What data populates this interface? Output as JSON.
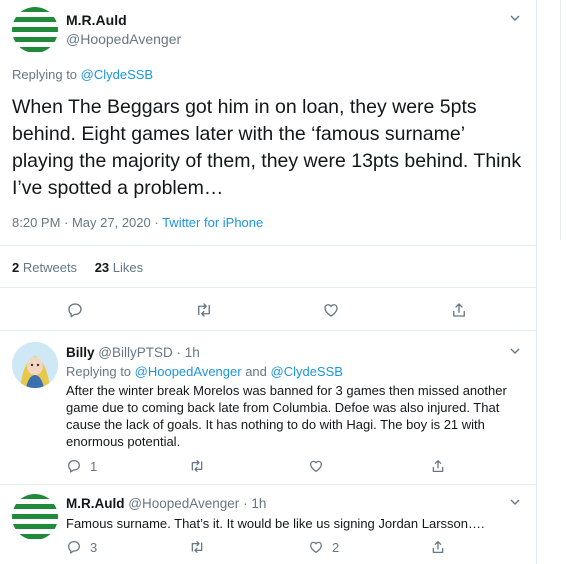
{
  "main_tweet": {
    "author_name": "M.R.Auld",
    "author_handle": "@HoopedAvenger",
    "replying_prefix": "Replying to ",
    "replying_to": "@ClydeSSB",
    "text": "When The Beggars got him in on loan, they were 5pts behind. Eight games later with the ‘famous surname’ playing the majority of them, they were 13pts behind. Think I’ve spotted a problem…",
    "timestamp": "8:20 PM · May 27, 2020",
    "source_sep": " · ",
    "source": "Twitter for iPhone",
    "retweets_count": "2",
    "retweets_label": "Retweets",
    "likes_count": "23",
    "likes_label": "Likes"
  },
  "replies": [
    {
      "author_name": "Billy",
      "author_handle": "@BillyPTSD",
      "sep": " · ",
      "time": "1h",
      "replying_prefix": "Replying to ",
      "replying_to_1": "@HoopedAvenger",
      "and": " and ",
      "replying_to_2": "@ClydeSSB",
      "text": "After the winter break Morelos was banned for 3 games then missed another game due to coming back late from Columbia. Defoe was also injured. That cause the lack of goals. It has nothing to do with Hagi. The boy is 21 with enormous potential.",
      "reply_count": "1",
      "retweet_count": "",
      "like_count": ""
    },
    {
      "author_name": "M.R.Auld",
      "author_handle": "@HoopedAvenger",
      "sep": " · ",
      "time": "1h",
      "text": "Famous surname. That’s it. It would be like us signing Jordan Larsson….",
      "reply_count": "3",
      "retweet_count": "",
      "like_count": "2"
    }
  ],
  "icons": [
    "reply-icon",
    "retweet-icon",
    "like-icon",
    "share-icon",
    "chevron-down-icon"
  ],
  "colors": {
    "link": "#1b95e0",
    "muted": "#657786",
    "border": "#e6ecf0",
    "stripe_green": "#1f8a3a"
  }
}
